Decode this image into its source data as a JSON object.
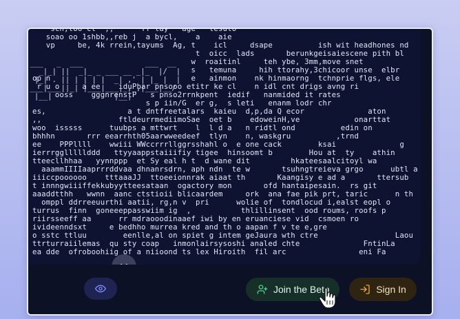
{
  "ascii_art": {
    "lines": [
      "    sch,too ct  ,,      ff tay   age   lesuto",
      "   soao oo 1shbb,,reb j  a bycl,    a    aie",
      "   vp     be, 4k rrein,tayums  Ag, t    icl     dsape          ish wit headhones nd",
      "                                    t  oicc  lads       berunkgeisaiescene pith bl",
      "                                   w  roaitinl     teh ybe, 3mm,move snet",
      "                                   s   temuna     hih ttorahy,3chicoor unse  elbr",
      "op n                               e   ainmon    nk hinmaorng  tchnprie flgs, ele",
      " r u o     a ee    iduPbar pnsooo etitr ke cl    n idl cnt drigs avng ri",
      "     ooss    gggnrenstP   s pnso2rrnkpent  iedif   nanmided it rates",
      "                         s p iin/G  er g,  s leti   enanm lodr chr",
      "es,                  a t dntfreetalars  kaieu  d,p,da Q ecor              aton",
      ",,                 ftldeurrmediimoSae  oet b    edoweinH,ve            onarttat",
      "woo  isssss      tuubps a mttwrt    l  l d a   n ridtl ond          edin on",
      "bhhhn       rrr eearrhth05aarwweedeef  tlyn    n, waskgru          ,trnd",
      "ee    PPPllll    wwiii WWccrrrllggrsshahl o  e one cack        ksai              g",
      "ierrrgglllllddd   ttyyaappstaiiifiy tigee  hinsoomt b        Hou at  ty    athin",
      "tteecllhhaa   yynnppp  et Sy eal h t  d wane dit         hkateesaalcitoyl wa",
      "  aaammIIIIaaprrrddvaa dhnanrsdrn, aph ndn  te w       tsuhngtreieva grgo      ubtl a",
      "iiiccpoooooo    tttaaaJJ  ttoeeionnrak aiaat th       Kaangisy e ad a       ttersub",
      "t innngwiiiffekkubyytteesataan  ogactory mon       ofd hantaipesain.  rs git",
      "aaaddtthh   wwnn  aanc ctstioii blicaardem     ork  ana fae pik prt, taric      n th",
      "  omppl ddrreeuurthi aatii, rg,n v  pri      wolie of  tondlocud i,ealst eopl o",
      "turrus  finn  goneeeppasswiim ig  ,           thlillinsent  ood roums, roofs p",
      "riirsseeff aa      rr mdraooodinaaef iwi by en eruanciese vid  csmoen ro",
      "ivideenndsxt     e bedhho murrea kred and th o aapan f v te e,gre",
      "o sstc ttluu        eenlle,al on spiet g intem geJaura wth ctre                 Laou",
      "ttrturraiilemas  qu sty coap   inmonlairsysoshi analed chte              FntinLa",
      "ea dde  ofroboohiig of a niioond ts lex Hiroith  fil arc                eni Fa"
    ],
    "logo_lines": [
      " ___   _  ___              ___  __",
      "|  _|_| ||  _|_ _ ___ __ _|_  |/  |",
      "| |_| . || | | | |  _| ,' | |_ |  |",
      "|___|___||_| |___|___|_,_,|___|__/ ",
      "  |__|              |__|"
    ]
  },
  "icons": {
    "scroll": "chevrons-down-icon",
    "eye": "eye-icon",
    "join": "user-plus-icon",
    "signin": "sign-in-icon",
    "cursor": "hand-pointer-icon"
  },
  "buttons": {
    "join_label": "Join the Beta",
    "signin_label": "Sign In"
  },
  "colors": {
    "join_accent": "#4fd08f",
    "signin_accent": "#f0a93c",
    "eye_accent": "#7f8cff"
  }
}
